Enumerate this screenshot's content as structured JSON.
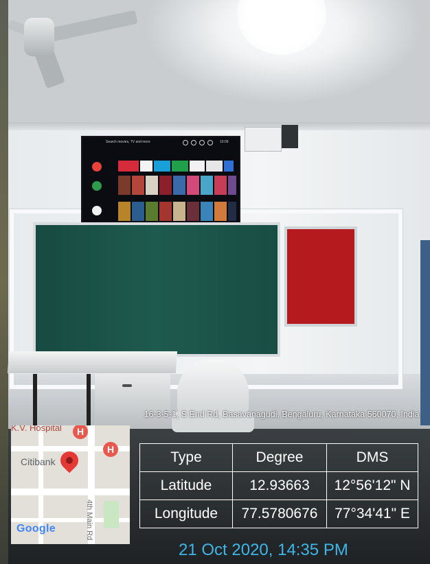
{
  "photo": {
    "description": "Classroom with wall-mounted smart TV, green chalkboard and red notice board"
  },
  "tv_screen": {
    "search_text": "Search movies, TV and more",
    "time": "10:09"
  },
  "overlay": {
    "address": "16-3-5-1, S End Rd, Basavanagudi, Bengaluru, Karnataka 560070, India",
    "map": {
      "top_label": "K.V. Hospital",
      "place_label": "Citibank",
      "road_label": "4th Main Rd",
      "logo": "Google",
      "marker_symbol": "H"
    },
    "table": {
      "headers": [
        "Type",
        "Degree",
        "DMS"
      ],
      "rows": [
        [
          "Latitude",
          "12.93663",
          "12°56'12\" N"
        ],
        [
          "Longitude",
          "77.5780676",
          "77°34'41\" E"
        ]
      ]
    },
    "datetime": "21 Oct 2020, 14:35 PM"
  },
  "colors": {
    "chalkboard": "#1f5a4e",
    "pinboard": "#b51a1f",
    "datetime": "#3fb6e8",
    "map_pin": "#e53935"
  }
}
